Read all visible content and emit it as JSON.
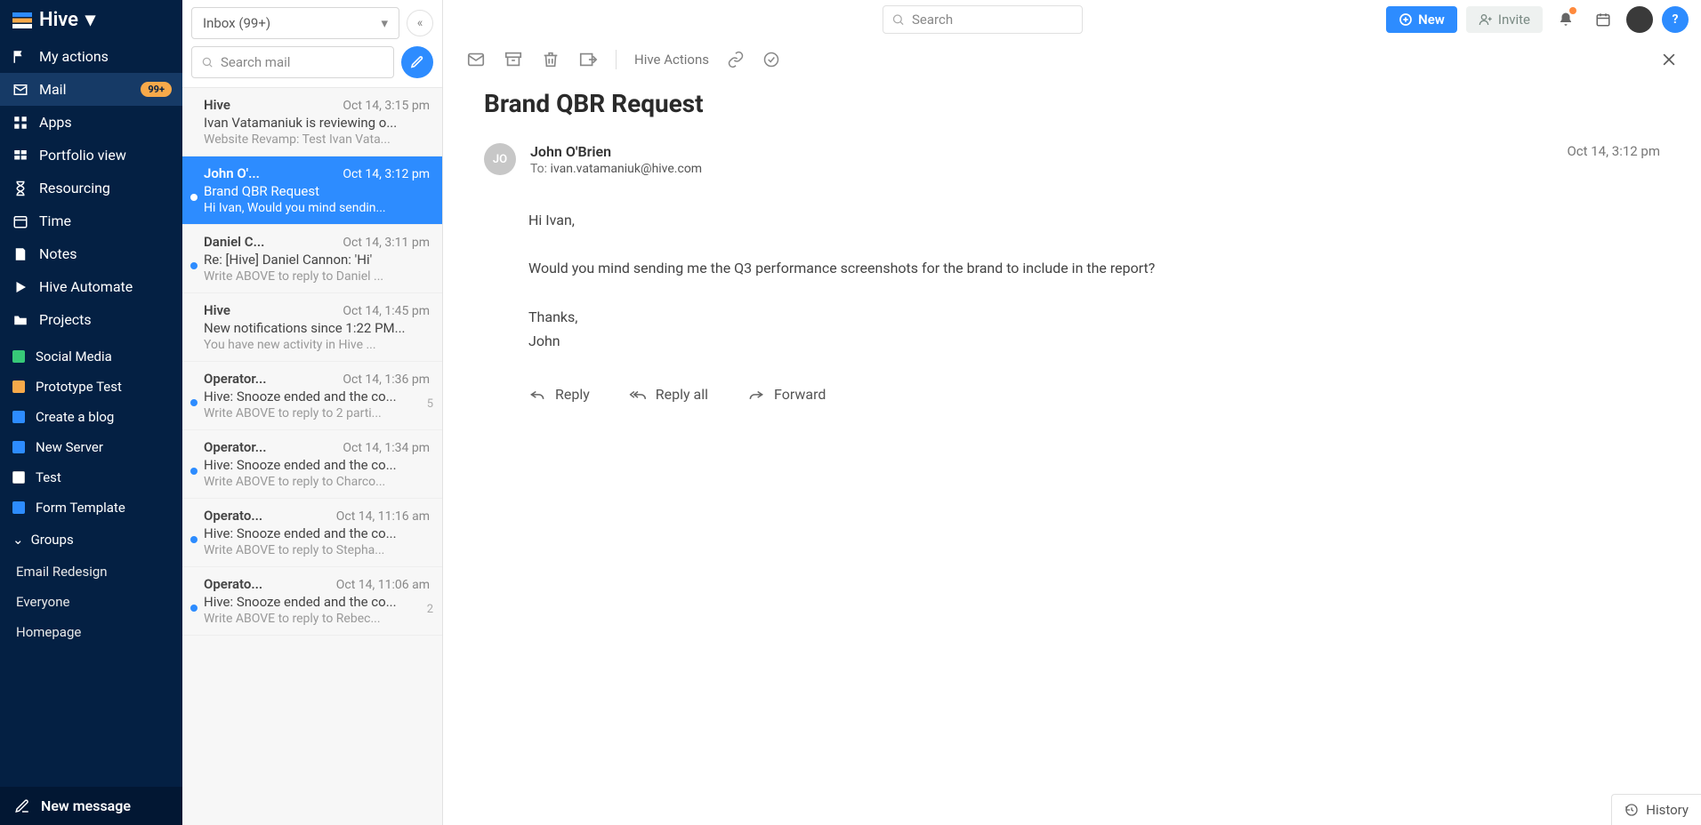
{
  "brand": "Hive",
  "sidebar": {
    "nav": [
      {
        "icon": "user-flag",
        "label": "My actions"
      },
      {
        "icon": "envelope",
        "label": "Mail",
        "badge": "99+",
        "active": true
      },
      {
        "icon": "grid",
        "label": "Apps"
      },
      {
        "icon": "portfolio",
        "label": "Portfolio view"
      },
      {
        "icon": "hourglass",
        "label": "Resourcing"
      },
      {
        "icon": "calendar",
        "label": "Time"
      },
      {
        "icon": "note",
        "label": "Notes"
      },
      {
        "icon": "play",
        "label": "Hive Automate"
      },
      {
        "icon": "folder",
        "label": "Projects"
      }
    ],
    "projects": [
      {
        "color": "#37c978",
        "label": "Social Media"
      },
      {
        "color": "#f7a94a",
        "label": "Prototype Test"
      },
      {
        "color": "#2d8cff",
        "label": "Create a blog"
      },
      {
        "color": "#2d8cff",
        "label": "New Server"
      },
      {
        "color": "#ffffff",
        "label": "Test"
      },
      {
        "color": "#2d8cff",
        "label": "Form Template"
      }
    ],
    "groups_header": "Groups",
    "groups": [
      "Email Redesign",
      "Everyone",
      "Homepage"
    ],
    "new_message": "New message"
  },
  "mailcol": {
    "folder": "Inbox (99+)",
    "search_placeholder": "Search mail",
    "items": [
      {
        "sender": "Hive",
        "time": "Oct 14, 3:15 pm",
        "subject": "Ivan Vatamaniuk is reviewing o...",
        "preview": "Website Revamp: Test Ivan Vata...",
        "unread": false
      },
      {
        "sender": "John O'...",
        "time": "Oct 14, 3:12 pm",
        "subject": "Brand QBR Request",
        "preview": "Hi Ivan, Would you mind sendin...",
        "unread": true,
        "selected": true
      },
      {
        "sender": "Daniel C...",
        "time": "Oct 14, 3:11 pm",
        "subject": "Re: [Hive] Daniel Cannon: 'Hi'",
        "preview": "Write ABOVE to reply to Daniel ...",
        "unread": true
      },
      {
        "sender": "Hive",
        "time": "Oct 14, 1:45 pm",
        "subject": "New notifications since 1:22 PM...",
        "preview": "You have new activity in Hive ...",
        "unread": false
      },
      {
        "sender": "Operator...",
        "time": "Oct 14, 1:36 pm",
        "subject": "Hive: Snooze ended and the co...",
        "preview": "Write ABOVE to reply to 2 parti...",
        "unread": true,
        "count": "5"
      },
      {
        "sender": "Operator...",
        "time": "Oct 14, 1:34 pm",
        "subject": "Hive: Snooze ended and the co...",
        "preview": "Write ABOVE to reply to Charco...",
        "unread": true
      },
      {
        "sender": "Operato...",
        "time": "Oct 14, 11:16 am",
        "subject": "Hive: Snooze ended and the co...",
        "preview": "Write ABOVE to reply to Stepha...",
        "unread": true
      },
      {
        "sender": "Operato...",
        "time": "Oct 14, 11:06 am",
        "subject": "Hive: Snooze ended and the co...",
        "preview": "Write ABOVE to reply to Rebec...",
        "unread": true,
        "count": "2"
      }
    ]
  },
  "topbar": {
    "search_placeholder": "Search",
    "new_label": "New",
    "invite_label": "Invite"
  },
  "toolbar": {
    "hive_actions": "Hive Actions"
  },
  "email": {
    "subject": "Brand QBR Request",
    "sender_initials": "JO",
    "sender_name": "John O'Brien",
    "to_label": "To:",
    "to_addr": "ivan.vatamaniuk@hive.com",
    "time": "Oct 14, 3:12 pm",
    "body_line1": "Hi Ivan,",
    "body_line2": "Would you mind sending me the Q3 performance screenshots for the brand to include in the report?",
    "body_line3": "Thanks,",
    "body_line4": "John",
    "reply": "Reply",
    "reply_all": "Reply all",
    "forward": "Forward"
  },
  "history": "History"
}
